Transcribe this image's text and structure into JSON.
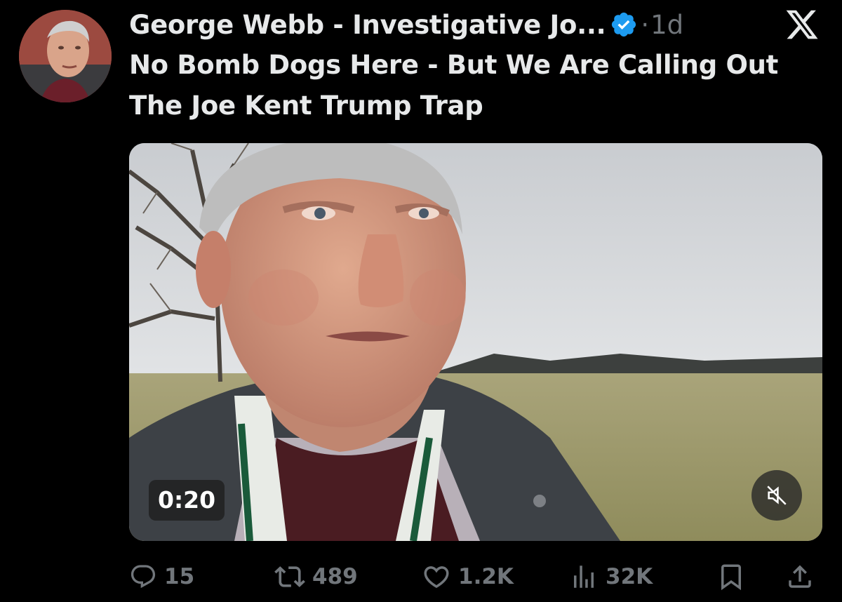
{
  "tweet": {
    "author_name": "George Webb - Investigative Jo...",
    "verified": true,
    "separator": "·",
    "time": "1d",
    "text": "No Bomb Dogs Here - But We Are Calling Out The Joe Kent Trump Trap"
  },
  "media": {
    "type": "video",
    "duration": "0:20",
    "muted": true
  },
  "actions": {
    "replies": "15",
    "reposts": "489",
    "likes": "1.2K",
    "views": "32K"
  },
  "colors": {
    "background": "#000000",
    "text": "#e7e9ea",
    "secondary": "#71767b",
    "verified_blue": "#1d9bf0"
  },
  "icons": [
    "x-logo-icon",
    "verified-badge-icon",
    "reply-icon",
    "repost-icon",
    "like-icon",
    "views-icon",
    "bookmark-icon",
    "share-icon",
    "mute-icon"
  ]
}
